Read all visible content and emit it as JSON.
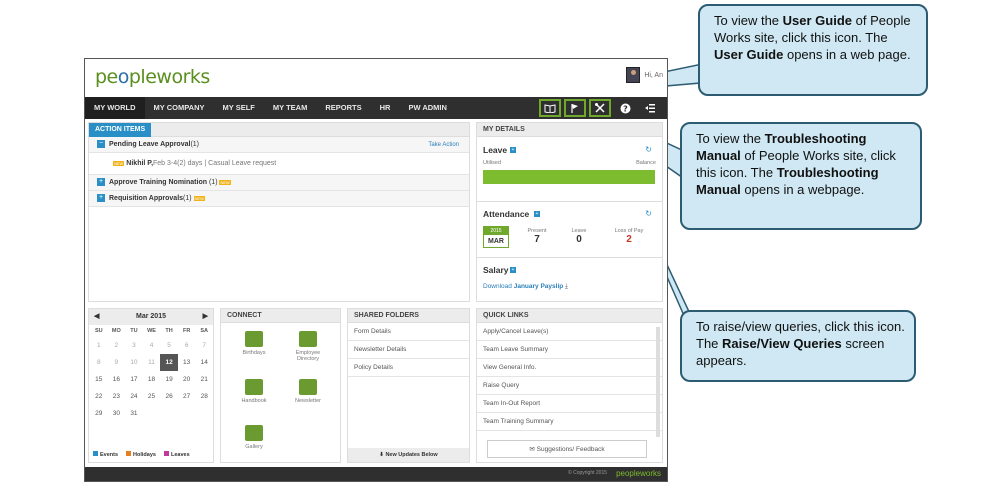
{
  "app": {
    "logo_part1": "pe",
    "logo_o": "o",
    "logo_part2": "ple",
    "logo_part3": "works",
    "user_greeting": "Hi, An"
  },
  "nav": {
    "items": [
      "MY WORLD",
      "MY COMPANY",
      "MY SELF",
      "MY TEAM",
      "REPORTS",
      "HR",
      "PW ADMIN"
    ],
    "active": "MY WORLD",
    "icons": [
      "user-guide-icon",
      "troubleshooting-manual-icon",
      "raise-queries-icon",
      "help-icon",
      "menu-icon"
    ]
  },
  "action_items": {
    "tab": "ACTION ITEMS",
    "pending_leave": "Pending Leave Approval",
    "pending_leave_count": "(1)",
    "take_action": "Take Action",
    "request_name": "Nikhil P,",
    "request_detail": "Feb 3-4(2) days | Casual Leave request",
    "approve_training": "Approve Training Nomination",
    "approve_training_count": "(1)",
    "requisition": "Requisition Approvals",
    "requisition_count": "(1)",
    "new_badge": "NEW"
  },
  "my_details": {
    "header": "MY DETAILS",
    "leave_title": "Leave",
    "utilised": "Utilised",
    "balance": "Balance",
    "attendance_title": "Attendance",
    "year": "2015",
    "month": "MAR",
    "present_label": "Present",
    "present_value": "7",
    "leave_label": "Leave",
    "leave_value": "0",
    "lop_label": "Loss of Pay",
    "lop_value": "2",
    "salary_title": "Salary",
    "download_text": "Download",
    "payslip_link": "January Payslip"
  },
  "calendar": {
    "title": "Mar 2015",
    "days": [
      "SU",
      "MO",
      "TU",
      "WE",
      "TH",
      "FR",
      "SA"
    ],
    "weeks": [
      [
        "1",
        "2",
        "3",
        "4",
        "5",
        "6",
        "7"
      ],
      [
        "8",
        "9",
        "10",
        "11",
        "12",
        "13",
        "14"
      ],
      [
        "15",
        "16",
        "17",
        "18",
        "19",
        "20",
        "21"
      ],
      [
        "22",
        "23",
        "24",
        "25",
        "26",
        "27",
        "28"
      ],
      [
        "29",
        "30",
        "31",
        "",
        "",
        "",
        ""
      ]
    ],
    "today": "12",
    "legend_events": "Events",
    "legend_holidays": "Holidays",
    "legend_leaves": "Leaves"
  },
  "connect": {
    "header": "CONNECT",
    "birthdays": "Birthdays",
    "employee_directory_1": "Employee",
    "employee_directory_2": "Directory",
    "handbook": "Handbook",
    "newsletter": "Newsletter",
    "gallery": "Gallery"
  },
  "shared_folders": {
    "header": "SHARED FOLDERS",
    "items": [
      "Form Details",
      "Newsletter Details",
      "Policy Details"
    ],
    "updates": "New Updates Below"
  },
  "quick_links": {
    "header": "QUICK LINKS",
    "items": [
      "Apply/Cancel Leave(s)",
      "Team Leave Summary",
      "View General Info.",
      "Raise Query",
      "Team In-Out Report",
      "Team Training Summary"
    ],
    "suggestions": "Suggestions/ Feedback"
  },
  "footer": {
    "copyright": "© Copyright 2015",
    "logo": "peopleworks"
  },
  "callouts": {
    "guide_1": "To view the ",
    "guide_b1": "User Guide",
    "guide_2": " of People Works site, click this icon. The ",
    "guide_b2": "User Guide",
    "guide_3": " opens in a web page.",
    "trouble_1": "To view the ",
    "trouble_b1": "Troubleshooting Manual",
    "trouble_2": " of People Works site, click this icon. The ",
    "trouble_b2": "Troubleshooting Manual",
    "trouble_3": " opens in a webpage.",
    "raise_1": "To raise/view queries, click this icon. The ",
    "raise_b1": "Raise/View Queries",
    "raise_2": " screen appears."
  },
  "colors": {
    "accent_green": "#6fa82a",
    "accent_blue": "#2a8fc7",
    "nav_bg": "#2f2f2f",
    "callout_bg": "#cfe8f3",
    "callout_border": "#2d5c72",
    "lop_red": "#c0392b"
  }
}
